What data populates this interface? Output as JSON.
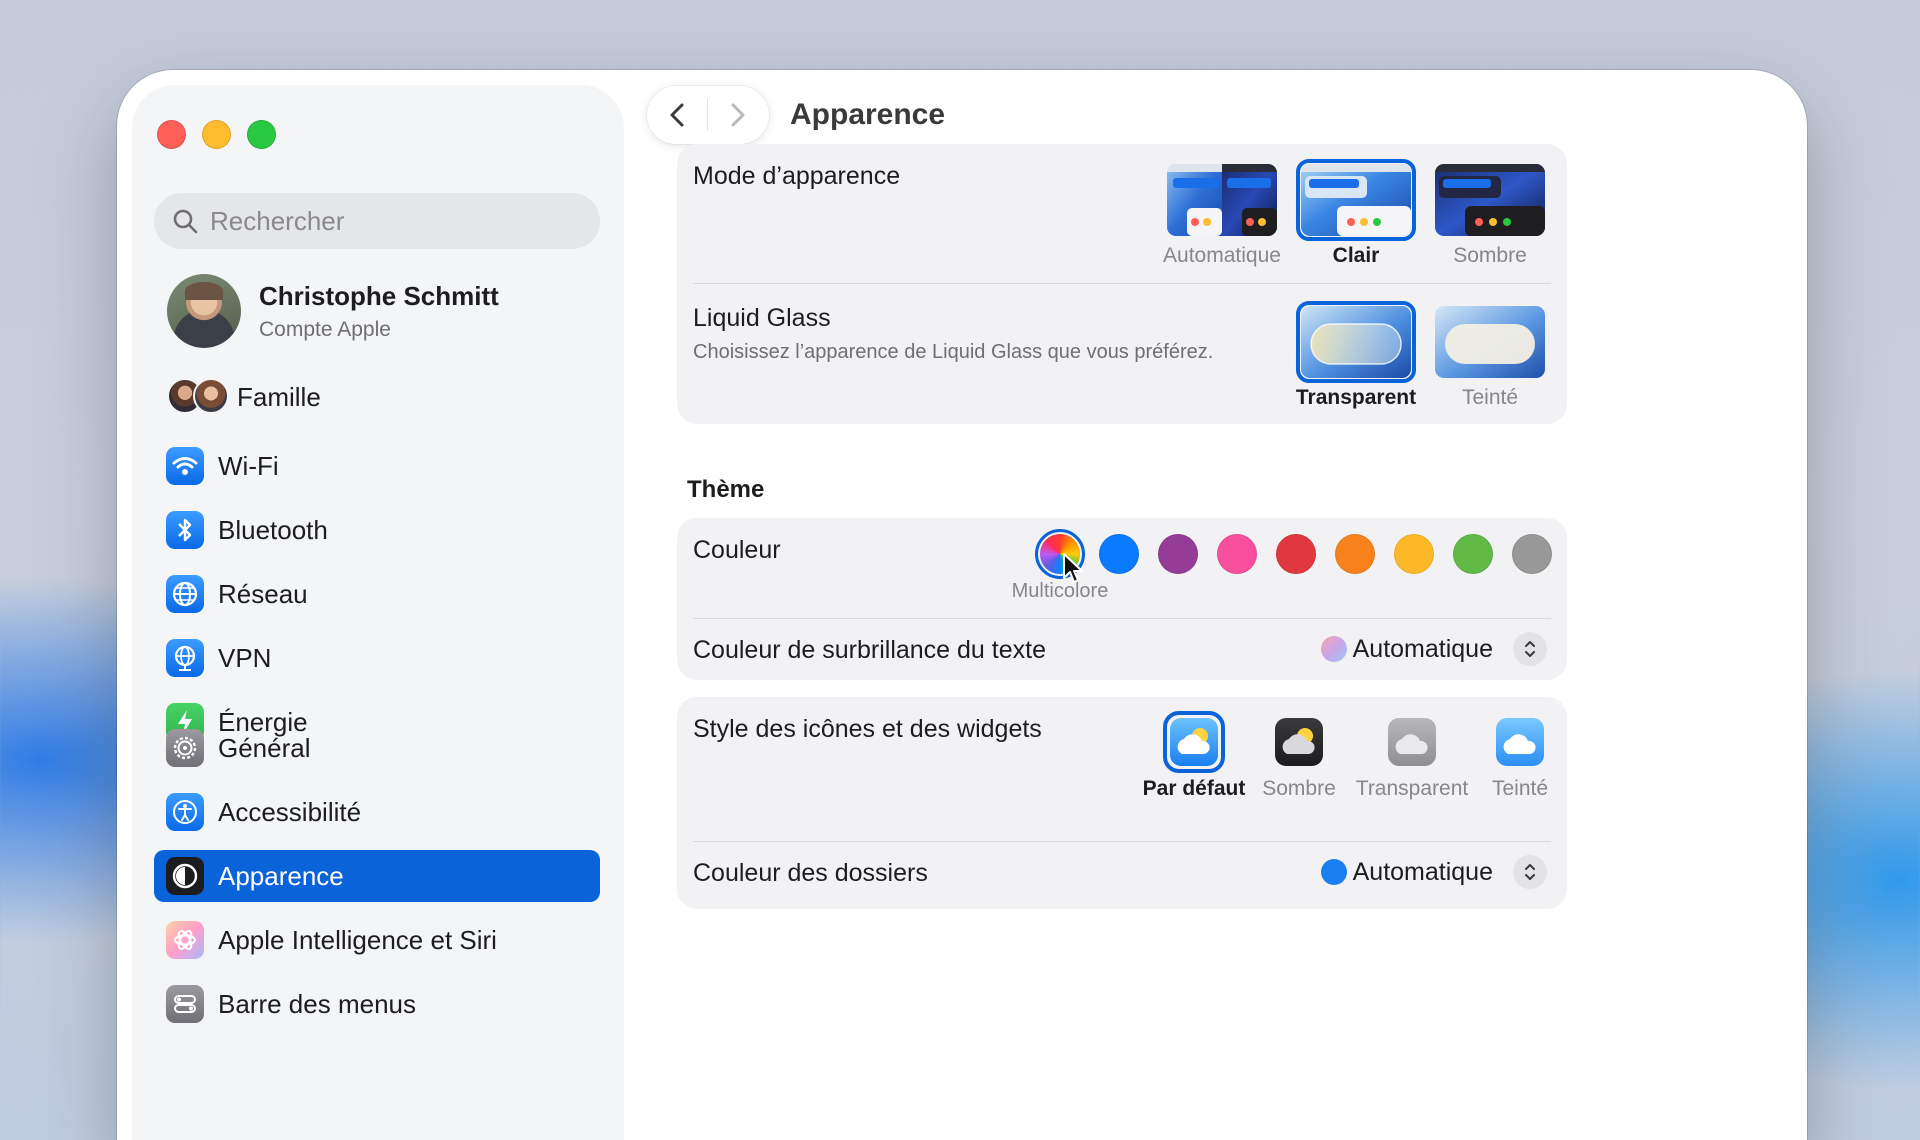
{
  "window": {
    "title": "Apparence"
  },
  "sidebar": {
    "search_placeholder": "Rechercher",
    "profile": {
      "name": "Christophe Schmitt",
      "subtitle": "Compte Apple"
    },
    "family": "Famille",
    "items": [
      {
        "label": "Wi-Fi",
        "icon": "wifi-icon"
      },
      {
        "label": "Bluetooth",
        "icon": "bluetooth-icon"
      },
      {
        "label": "Réseau",
        "icon": "globe-icon"
      },
      {
        "label": "VPN",
        "icon": "vpn-globe-icon"
      },
      {
        "label": "Énergie",
        "icon": "bolt-icon"
      },
      {
        "label": "Général",
        "icon": "gear-icon"
      },
      {
        "label": "Accessibilité",
        "icon": "accessibility-icon"
      },
      {
        "label": "Apparence",
        "icon": "appearance-icon",
        "selected": true
      },
      {
        "label": "Apple Intelligence et Siri",
        "icon": "siri-icon"
      },
      {
        "label": "Barre des menus",
        "icon": "menubar-icon"
      }
    ]
  },
  "appearance": {
    "mode": {
      "label": "Mode d’apparence",
      "options": [
        "Automatique",
        "Clair",
        "Sombre"
      ],
      "selected": "Clair"
    },
    "liquid_glass": {
      "label": "Liquid Glass",
      "description": "Choisissez l’apparence de Liquid Glass que vous préférez.",
      "options": [
        "Transparent",
        "Teinté"
      ],
      "selected": "Transparent"
    }
  },
  "theme": {
    "title": "Thème",
    "color": {
      "label": "Couleur",
      "selected_caption": "Multicolore",
      "swatches": [
        "#0a7aff",
        "#953d96",
        "#f74f9e",
        "#e0383e",
        "#f7821b",
        "#fcb827",
        "#62ba46",
        "#989898"
      ]
    },
    "highlight": {
      "label": "Couleur de surbrillance du texte",
      "value": "Automatique"
    }
  },
  "icons": {
    "style_label": "Style des icônes et des widgets",
    "options": [
      "Par défaut",
      "Sombre",
      "Transparent",
      "Teinté"
    ],
    "selected": "Par défaut",
    "folder_label": "Couleur des dossiers",
    "folder_value": "Automatique"
  },
  "colors": {
    "accent": "#0a63d8"
  }
}
